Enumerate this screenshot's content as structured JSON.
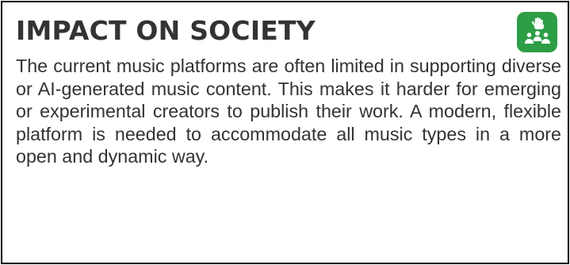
{
  "card": {
    "title": "IMPACT ON SOCIETY",
    "icon": "community-hand-icon",
    "icon_color": "#2e9e46",
    "body": "The current music platforms are often limited in supporting diverse or AI-generated music content. This makes it harder for emerging or experimental creators to publish their work. A modern, flexible platform is needed to accommodate all music types in a more open and dynamic way."
  }
}
